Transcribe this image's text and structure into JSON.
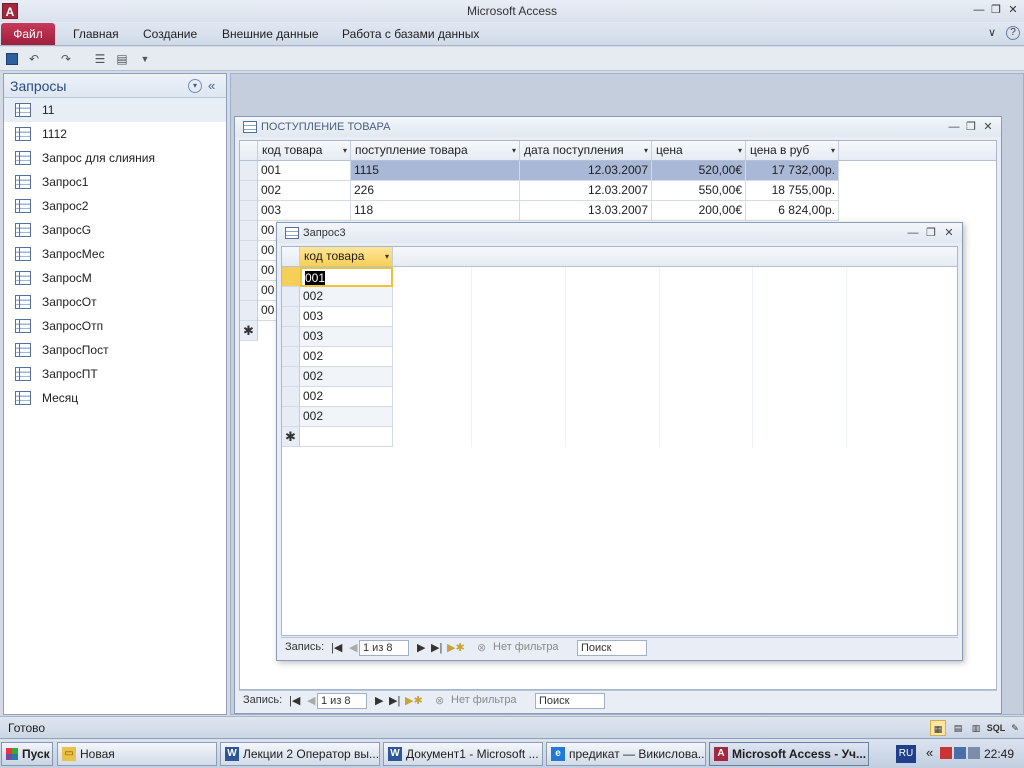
{
  "window": {
    "title": "Microsoft Access",
    "app_icon": "A",
    "minimize_glyph": "—",
    "restore_glyph": "❐",
    "close_glyph": "✕",
    "ribbon_min_glyph": "∨",
    "help_glyph": "?"
  },
  "ribbon": {
    "file_tab": "Файл",
    "tabs": [
      "Главная",
      "Создание",
      "Внешние данные",
      "Работа с базами данных"
    ]
  },
  "qat": {
    "icons": [
      "save-icon",
      "undo-icon",
      "redo-icon",
      "properties-icon",
      "print-icon",
      "customize-icon"
    ]
  },
  "nav": {
    "title": "Запросы",
    "dropdown_glyph": "▾",
    "collapse_glyph": "«",
    "items": [
      "11",
      "1112",
      "Запрос для слияния",
      "Запрос1",
      "Запрос2",
      "ЗапросG",
      "ЗапросМес",
      "ЗапросМ",
      "ЗапросОт",
      "ЗапросОтп",
      "ЗапросПост",
      "ЗапросПТ",
      "Месяц"
    ],
    "selected": "11"
  },
  "back_window": {
    "title": "ПОСТУПЛЕНИЕ ТОВАРА",
    "columns": [
      "код товара",
      "поступление товара",
      "дата поступления",
      "цена",
      "цена в руб"
    ],
    "rows": [
      [
        "001",
        "1115",
        "12.03.2007",
        "520,00€",
        "17 732,00р."
      ],
      [
        "002",
        "226",
        "12.03.2007",
        "550,00€",
        "18 755,00р."
      ],
      [
        "003",
        "118",
        "13.03.2007",
        "200,00€",
        "6 824,00р."
      ]
    ],
    "hidden_codes": [
      "00",
      "00",
      "00",
      "00",
      "00"
    ],
    "new_row_glyph": "✱",
    "record_bar": {
      "label": "Запись:",
      "position": "1 из 8",
      "filter": "Нет фильтра",
      "search": "Поиск"
    }
  },
  "front_window": {
    "title": "Запрос3",
    "column": "код товара",
    "rows": [
      "001",
      "002",
      "003",
      "003",
      "002",
      "002",
      "002",
      "002"
    ],
    "new_row_glyph": "✱",
    "record_bar": {
      "label": "Запись:",
      "position": "1 из 8",
      "filter": "Нет фильтра",
      "search": "Поиск"
    }
  },
  "nav_glyphs": {
    "first": "|◀",
    "prev": "◀",
    "next": "▶",
    "last": "▶|",
    "new": "▶✱"
  },
  "statusbar": {
    "text": "Готово",
    "sql_label": "SQL"
  },
  "taskbar": {
    "start": "Пуск",
    "buttons": [
      {
        "label": "Новая",
        "icon": "folder-icon"
      },
      {
        "label": "Лекции 2 Оператор вы...",
        "icon": "word-icon"
      },
      {
        "label": "Документ1 - Microsoft ...",
        "icon": "word-icon"
      },
      {
        "label": "предикат — Викислова...",
        "icon": "ie-icon"
      },
      {
        "label": "Microsoft Access - Уч...",
        "icon": "access-icon"
      }
    ],
    "lang": "RU",
    "tray_expand": "«",
    "time": "22:49"
  }
}
